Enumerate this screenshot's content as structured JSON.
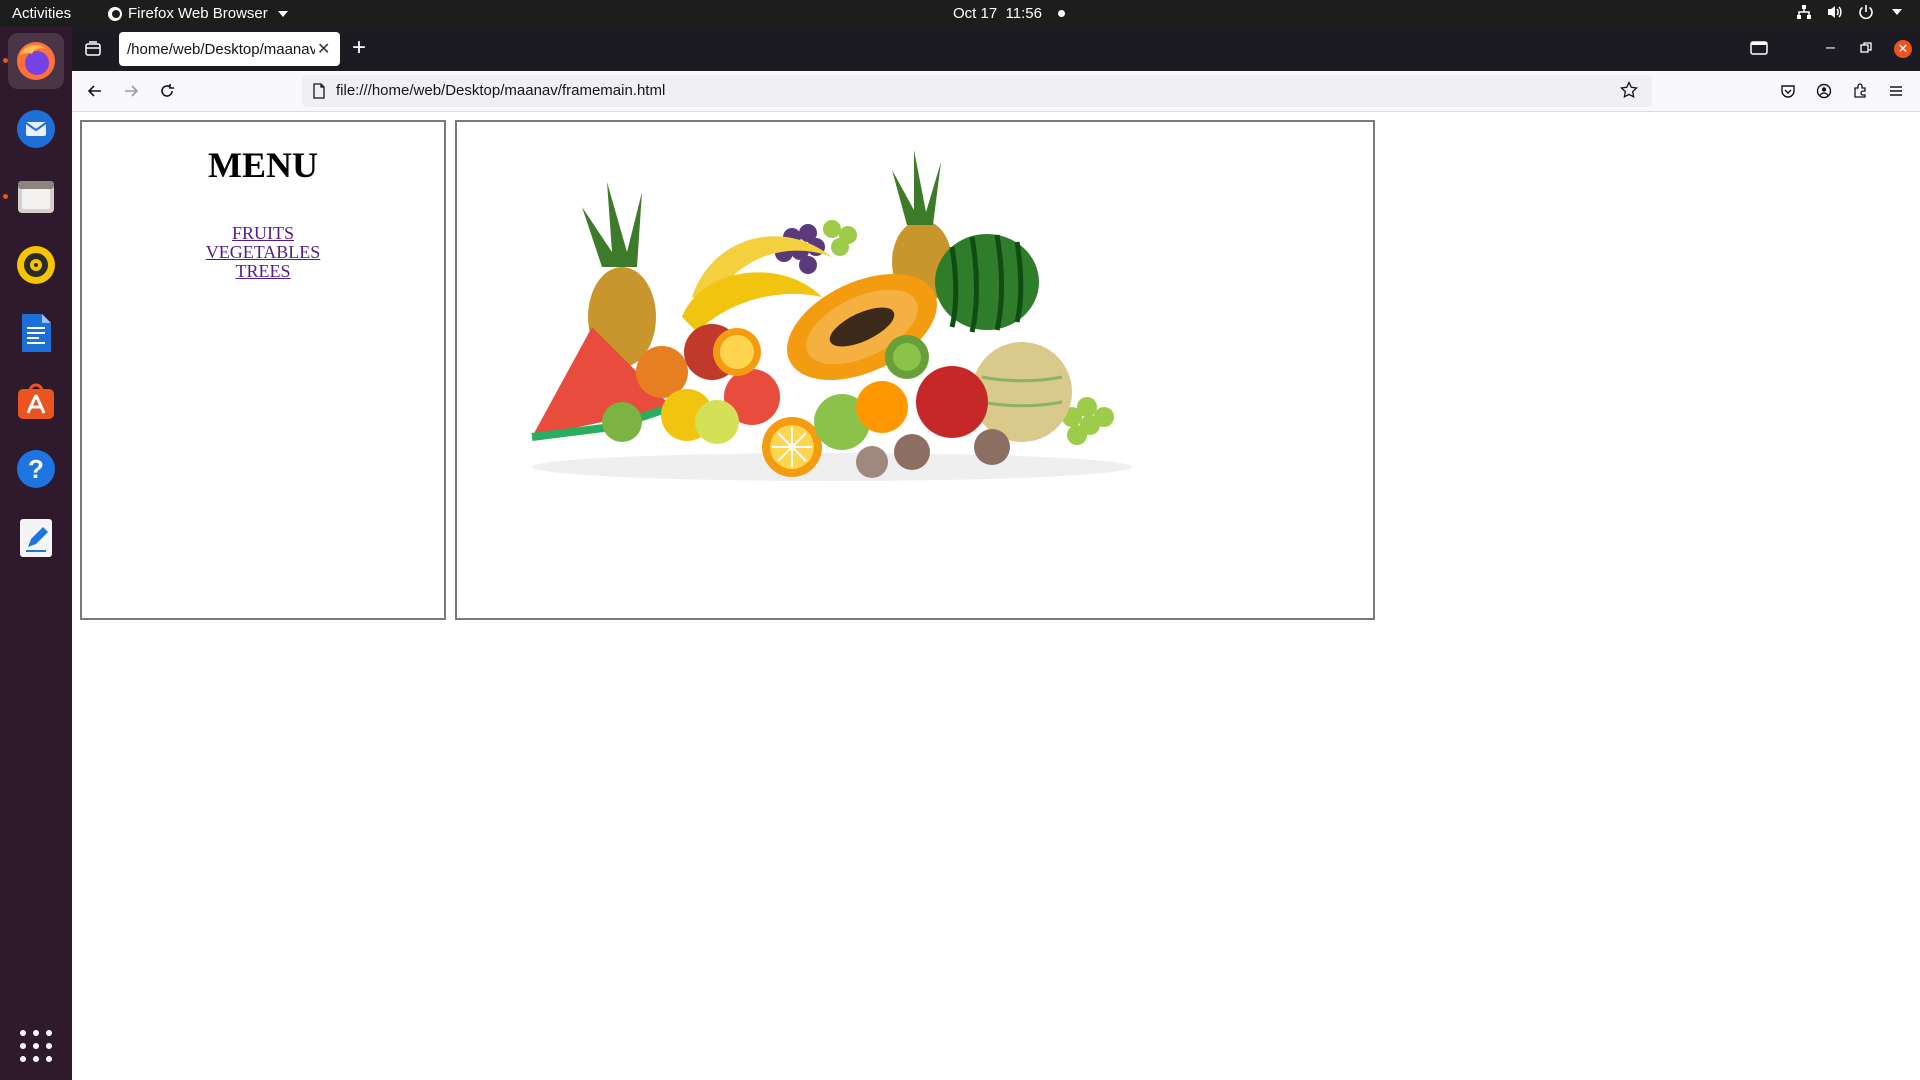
{
  "topbar": {
    "activities": "Activities",
    "app_name": "Firefox Web Browser",
    "date": "Oct 17",
    "time": "11:56"
  },
  "browser": {
    "tab_title": "/home/web/Desktop/maanav/framemain.html",
    "url": "file:///home/web/Desktop/maanav/framemain.html"
  },
  "dock": {
    "apps": [
      "firefox",
      "thunderbird",
      "files",
      "rhythmbox",
      "libreoffice-writer",
      "app-center",
      "help",
      "text-editor"
    ]
  },
  "page": {
    "menu_title": "MENU",
    "links": [
      "FRUITS",
      "VEGETABLES",
      "TREES"
    ]
  },
  "colors": {
    "accent": "#e95420",
    "visited_link": "#551a8b",
    "dock_bg": "#2e1a2c",
    "topbar_bg": "#1d1d1d"
  }
}
